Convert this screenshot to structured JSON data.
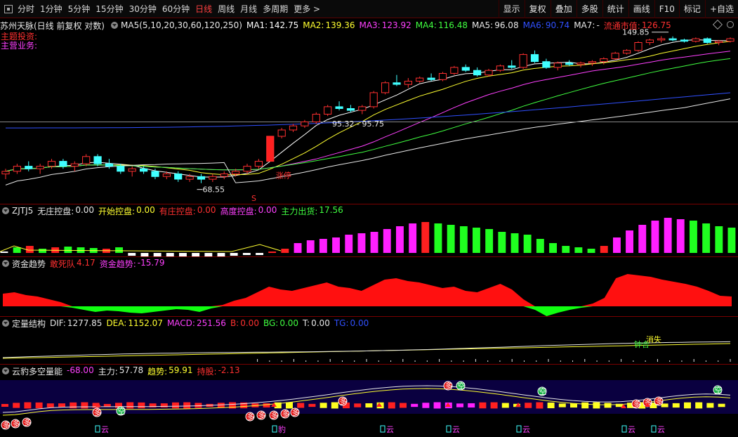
{
  "toolbar": {
    "periods": [
      {
        "label": "分时"
      },
      {
        "label": "1分钟"
      },
      {
        "label": "5分钟"
      },
      {
        "label": "15分钟"
      },
      {
        "label": "30分钟"
      },
      {
        "label": "60分钟"
      },
      {
        "label": "日线",
        "active": true
      },
      {
        "label": "周线"
      },
      {
        "label": "月线"
      },
      {
        "label": "多周期"
      },
      {
        "label": "更多 >"
      }
    ],
    "right": [
      "显示",
      "复权",
      "叠加",
      "多股",
      "统计",
      "画线",
      "F10",
      "标记",
      "+自选"
    ]
  },
  "main": {
    "title": "苏州天脉(日线 前复权 对数)",
    "ma_params": "MA5(5,10,20,30,60,120,250)",
    "ma": [
      {
        "label": "MA1:",
        "value": "142.75",
        "color": "#ffffff"
      },
      {
        "label": "MA2:",
        "value": "139.36",
        "color": "#ffff30"
      },
      {
        "label": "MA3:",
        "value": "123.92",
        "color": "#ff40ff"
      },
      {
        "label": "MA4:",
        "value": "116.48",
        "color": "#40ff40"
      },
      {
        "label": "MA5:",
        "value": "96.08",
        "color": "#e8e8e8"
      },
      {
        "label": "MA6:",
        "value": "90.74",
        "color": "#3050ff"
      },
      {
        "label": "MA7:",
        "value": "-",
        "color": "#e8e8e8"
      }
    ],
    "float_cap_label": "流通市值:",
    "float_cap_value": "126.75",
    "label_theme": "主题投资:",
    "label_business": "主营业务:",
    "annotation_high": "149.85",
    "annotation_low": "68.55",
    "annotation_mid": "95.32 - 95.75",
    "annotation_limit": "涨停",
    "annotation_s": "S"
  },
  "zjtj": {
    "name": "ZJTJ5",
    "items": [
      {
        "label": "无庄控盘:",
        "value": "0.00",
        "color": "#e8e8e8"
      },
      {
        "label": "开始控盘:",
        "value": "0.00",
        "color": "#ffff30"
      },
      {
        "label": "有庄控盘:",
        "value": "0.00",
        "color": "#ff3030"
      },
      {
        "label": "高度控盘:",
        "value": "0.00",
        "color": "#ff40ff"
      },
      {
        "label": "主力出货:",
        "value": "17.56",
        "color": "#40ff40"
      }
    ]
  },
  "zjqs": {
    "name": "资金趋势",
    "items": [
      {
        "label": "敢死队",
        "value": "4.17",
        "color": "#ff3030"
      },
      {
        "label": "资金趋势:",
        "value": "-15.79",
        "color": "#ff40ff"
      }
    ]
  },
  "ding": {
    "name": "定量结构",
    "items": [
      {
        "label": "DIF:",
        "value": "1277.85",
        "color": "#e8e8e8"
      },
      {
        "label": "DEA:",
        "value": "1152.07",
        "color": "#ffff30"
      },
      {
        "label": "MACD:",
        "value": "251.56",
        "color": "#ff40ff"
      },
      {
        "label": "B:",
        "value": "0.00",
        "color": "#ff3030"
      },
      {
        "label": "BG:",
        "value": "0.00",
        "color": "#40ff40"
      },
      {
        "label": "T:",
        "value": "0.00",
        "color": "#e8e8e8"
      },
      {
        "label": "TG:",
        "value": "0.00",
        "color": "#3050ff"
      }
    ],
    "ann_xiaoshi": "消失",
    "ann_zhonghe": "钟合"
  },
  "yun": {
    "name": "云豹多空量能",
    "items": [
      {
        "label": "",
        "value": "-68.00",
        "color": "#ff40ff"
      },
      {
        "label": "主力:",
        "value": "57.78",
        "color": "#e8e8e8"
      },
      {
        "label": "趋势:",
        "value": "59.91",
        "color": "#ffff30"
      },
      {
        "label": "持股:",
        "value": "-2.13",
        "color": "#ff3030"
      }
    ],
    "tag_yun": "云",
    "tag_bao": "豹",
    "circle_duo": "多",
    "circle_kong": "空"
  },
  "chart_data": {
    "type": "candlestick",
    "series": [
      {
        "name": "MA1",
        "color": "#ffffff"
      },
      {
        "name": "MA2",
        "color": "#ffff30"
      },
      {
        "name": "MA3",
        "color": "#ff40ff"
      },
      {
        "name": "MA4",
        "color": "#40ff40"
      },
      {
        "name": "MA5",
        "color": "#e8e8e8"
      },
      {
        "name": "MA6",
        "color": "#3050ff"
      }
    ],
    "candles": [
      [
        72,
        74,
        70,
        73
      ],
      [
        73,
        76,
        72,
        75
      ],
      [
        75,
        77,
        73,
        74
      ],
      [
        74,
        76,
        72,
        75
      ],
      [
        75,
        78,
        74,
        77
      ],
      [
        77,
        78,
        74,
        75
      ],
      [
        75,
        77,
        73,
        76
      ],
      [
        76,
        80,
        75,
        79
      ],
      [
        79,
        80,
        75,
        76
      ],
      [
        76,
        78,
        74,
        75
      ],
      [
        75,
        76,
        72,
        73
      ],
      [
        73,
        75,
        71,
        74
      ],
      [
        74,
        75,
        72,
        73
      ],
      [
        73,
        74,
        70,
        71
      ],
      [
        71,
        73,
        70,
        72
      ],
      [
        72,
        73,
        69,
        70
      ],
      [
        70,
        72,
        69,
        71
      ],
      [
        71,
        72,
        68.55,
        70
      ],
      [
        70,
        72,
        69,
        71
      ],
      [
        71,
        73,
        70,
        72
      ],
      [
        72,
        74,
        71,
        73
      ],
      [
        73,
        76,
        72,
        75
      ],
      [
        75,
        78,
        74,
        77
      ],
      [
        77,
        88,
        77,
        88
      ],
      [
        88,
        92,
        87,
        91
      ],
      [
        91,
        94,
        90,
        93
      ],
      [
        93,
        96,
        92,
        95
      ],
      [
        95,
        100,
        94,
        99
      ],
      [
        99,
        104,
        98,
        103
      ],
      [
        103,
        106,
        101,
        102
      ],
      [
        102,
        104,
        100,
        101
      ],
      [
        101,
        104,
        99,
        103
      ],
      [
        103,
        112,
        102,
        111
      ],
      [
        111,
        118,
        110,
        117
      ],
      [
        117,
        122,
        115,
        116
      ],
      [
        116,
        120,
        114,
        118
      ],
      [
        118,
        121,
        117,
        120
      ],
      [
        120,
        123,
        118,
        119
      ],
      [
        119,
        124,
        118,
        123
      ],
      [
        123,
        128,
        122,
        127
      ],
      [
        127,
        129,
        124,
        125
      ],
      [
        125,
        127,
        121,
        122
      ],
      [
        122,
        126,
        121,
        125
      ],
      [
        125,
        129,
        124,
        128
      ],
      [
        128,
        132,
        126,
        127
      ],
      [
        127,
        137,
        126,
        136
      ],
      [
        136,
        139,
        130,
        131
      ],
      [
        131,
        133,
        126,
        127
      ],
      [
        127,
        131,
        125,
        130
      ],
      [
        130,
        132,
        128,
        129
      ],
      [
        129,
        131,
        127,
        130
      ],
      [
        130,
        132,
        128,
        131
      ],
      [
        131,
        134,
        129,
        133
      ],
      [
        133,
        138,
        132,
        137
      ],
      [
        137,
        140,
        136,
        139
      ],
      [
        139,
        146,
        138,
        145
      ],
      [
        145,
        148,
        143,
        147
      ],
      [
        147,
        150,
        145,
        148
      ],
      [
        148,
        149.85,
        146,
        147
      ],
      [
        147,
        148,
        145,
        146
      ],
      [
        146,
        149,
        145,
        148
      ],
      [
        148,
        149,
        144,
        145
      ],
      [
        145,
        147,
        143,
        146
      ],
      [
        146,
        149,
        145,
        148
      ]
    ],
    "zjtj_bars": [
      {
        "v": 2,
        "c": "w"
      },
      {
        "v": 8,
        "c": "g"
      },
      {
        "v": 10,
        "c": "r"
      },
      {
        "v": 6,
        "c": "g"
      },
      {
        "v": 8,
        "c": "r"
      },
      {
        "v": 9,
        "c": "g"
      },
      {
        "v": 8,
        "c": "g"
      },
      {
        "v": 7,
        "c": "g"
      },
      {
        "v": 6,
        "c": "r"
      },
      {
        "v": 8,
        "c": "g"
      },
      {
        "v": -4,
        "c": "w"
      },
      {
        "v": -5,
        "c": "w"
      },
      {
        "v": -6,
        "c": "w"
      },
      {
        "v": -7,
        "c": "w"
      },
      {
        "v": -8,
        "c": "w"
      },
      {
        "v": -7,
        "c": "w"
      },
      {
        "v": -6,
        "c": "w"
      },
      {
        "v": -5,
        "c": "w"
      },
      {
        "v": -4,
        "c": "w"
      },
      {
        "v": -3,
        "c": "w"
      },
      {
        "v": -3,
        "c": "w"
      },
      {
        "v": 2,
        "c": "r"
      },
      {
        "v": 6,
        "c": "r"
      },
      {
        "v": 14,
        "c": "m"
      },
      {
        "v": 18,
        "c": "m"
      },
      {
        "v": 20,
        "c": "m"
      },
      {
        "v": 22,
        "c": "m"
      },
      {
        "v": 26,
        "c": "m"
      },
      {
        "v": 28,
        "c": "m"
      },
      {
        "v": 30,
        "c": "m"
      },
      {
        "v": 34,
        "c": "m"
      },
      {
        "v": 38,
        "c": "m"
      },
      {
        "v": 42,
        "c": "m"
      },
      {
        "v": 44,
        "c": "r"
      },
      {
        "v": 42,
        "c": "g"
      },
      {
        "v": 40,
        "c": "g"
      },
      {
        "v": 38,
        "c": "g"
      },
      {
        "v": 36,
        "c": "g"
      },
      {
        "v": 34,
        "c": "g"
      },
      {
        "v": 30,
        "c": "g"
      },
      {
        "v": 28,
        "c": "g"
      },
      {
        "v": 26,
        "c": "g"
      },
      {
        "v": 20,
        "c": "g"
      },
      {
        "v": 14,
        "c": "g"
      },
      {
        "v": 10,
        "c": "g"
      },
      {
        "v": 8,
        "c": "g"
      },
      {
        "v": 6,
        "c": "g"
      },
      {
        "v": 10,
        "c": "r"
      },
      {
        "v": 22,
        "c": "m"
      },
      {
        "v": 32,
        "c": "m"
      },
      {
        "v": 40,
        "c": "m"
      },
      {
        "v": 46,
        "c": "m"
      },
      {
        "v": 50,
        "c": "m"
      },
      {
        "v": 48,
        "c": "m"
      },
      {
        "v": 46,
        "c": "g"
      },
      {
        "v": 42,
        "c": "g"
      },
      {
        "v": 38,
        "c": "g"
      },
      {
        "v": 36,
        "c": "g"
      }
    ],
    "zjqs_values": [
      18,
      20,
      16,
      14,
      10,
      6,
      -2,
      -5,
      -8,
      -6,
      -7,
      -9,
      -10,
      -8,
      -6,
      -4,
      -5,
      -8,
      -3,
      2,
      8,
      12,
      20,
      28,
      24,
      22,
      26,
      30,
      34,
      28,
      26,
      22,
      30,
      38,
      40,
      36,
      34,
      30,
      26,
      28,
      22,
      20,
      26,
      32,
      24,
      10,
      -5,
      -14,
      -9,
      -5,
      -2,
      4,
      12,
      40,
      46,
      44,
      42,
      38,
      35,
      32,
      28,
      22,
      15,
      14
    ]
  }
}
